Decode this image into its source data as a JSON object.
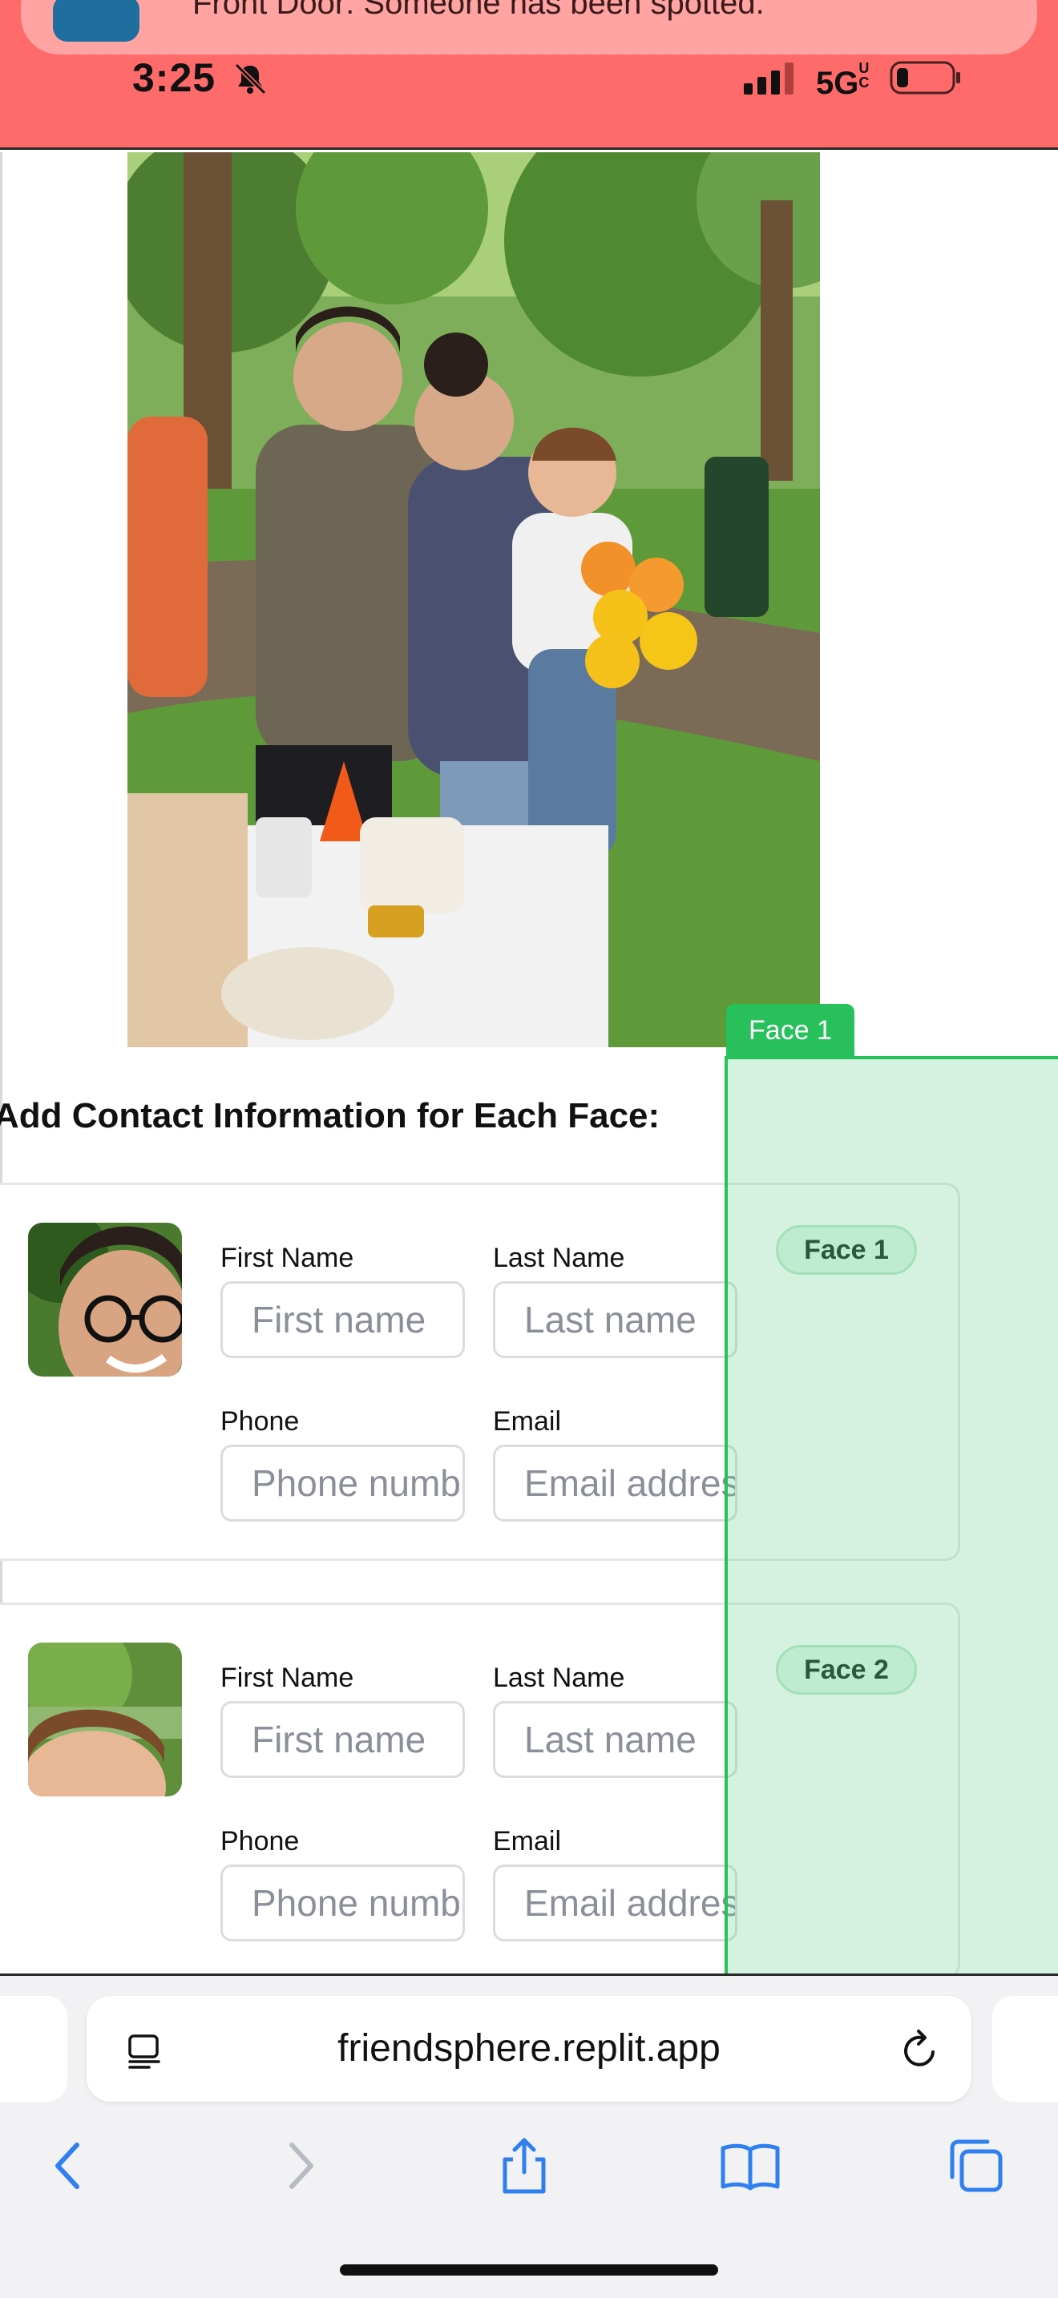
{
  "status_bar": {
    "notification_text": "Front Door: Someone has been spotted.",
    "time": "3:25",
    "network": "5G",
    "network_suffix": "UC",
    "colors": {
      "banner": "#ff6b6b"
    }
  },
  "main": {
    "heading": "Add Contact Information for Each Face:",
    "faces": [
      {
        "pill": "Face 1",
        "labels": {
          "first": "First Name",
          "last": "Last Name",
          "phone": "Phone",
          "email": "Email"
        },
        "placeholders": {
          "first": "First name",
          "last": "Last name",
          "phone": "Phone number",
          "email": "Email address"
        }
      },
      {
        "pill": "Face 2",
        "labels": {
          "first": "First Name",
          "last": "Last Name",
          "phone": "Phone",
          "email": "Email"
        },
        "placeholders": {
          "first": "First name",
          "last": "Last name",
          "phone": "Phone number",
          "email": "Email address"
        }
      }
    ]
  },
  "overlay": {
    "tag": "Face 1",
    "color": "#27c05a"
  },
  "browser": {
    "url": "friendsphere.replit.app",
    "icons": [
      "reader-icon",
      "reload-icon",
      "back-icon",
      "forward-icon",
      "share-icon",
      "bookmarks-icon",
      "tabs-icon"
    ]
  }
}
